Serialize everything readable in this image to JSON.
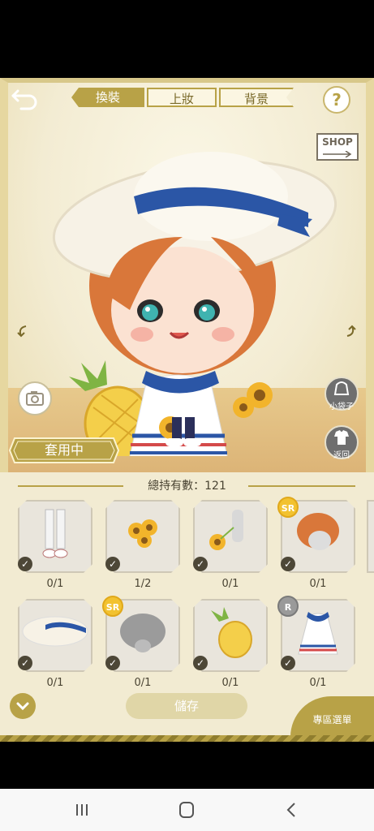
{
  "tabs": [
    {
      "label": "換裝",
      "active": true
    },
    {
      "label": "上妝",
      "active": false
    },
    {
      "label": "背景",
      "active": false
    }
  ],
  "shop_label": "SHOP",
  "help_label": "?",
  "side_buttons": {
    "bag_label": "小袋子",
    "return_label": "返回"
  },
  "in_use_label": "套用中",
  "total_label": "總持有數：121",
  "items_row1": [
    {
      "name": "white-boots",
      "count": "0/1",
      "badge": ""
    },
    {
      "name": "sunflower-bouquet",
      "count": "1/2",
      "badge": ""
    },
    {
      "name": "sunflower-bottle",
      "count": "0/1",
      "badge": ""
    },
    {
      "name": "auburn-hair",
      "count": "0/1",
      "badge": "SR"
    }
  ],
  "items_row2": [
    {
      "name": "sailor-hat",
      "count": "0/1",
      "badge": ""
    },
    {
      "name": "grey-bob-hair",
      "count": "0/1",
      "badge": "SR"
    },
    {
      "name": "pineapple",
      "count": "0/1",
      "badge": ""
    },
    {
      "name": "sailor-dress",
      "count": "0/1",
      "badge": "R"
    }
  ],
  "save_label": "儲存",
  "special_label": "專區選單",
  "colors": {
    "accent": "#b8a247",
    "panel": "#f2ebd2",
    "cream": "#f3ecd3"
  }
}
